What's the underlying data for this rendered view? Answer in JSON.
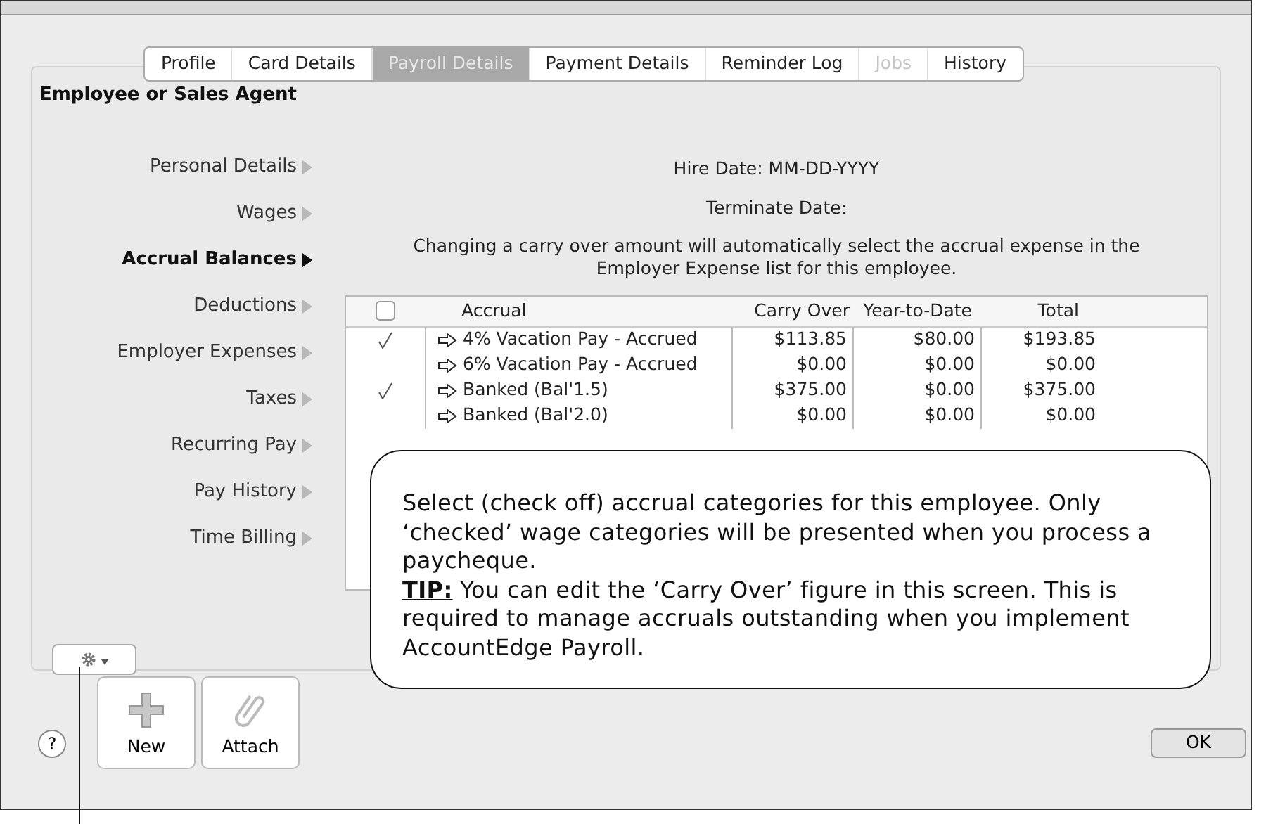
{
  "tabs": [
    {
      "label": "Profile",
      "selected": false,
      "disabled": false
    },
    {
      "label": "Card Details",
      "selected": false,
      "disabled": false
    },
    {
      "label": "Payroll Details",
      "selected": true,
      "disabled": false
    },
    {
      "label": "Payment Details",
      "selected": false,
      "disabled": false
    },
    {
      "label": "Reminder Log",
      "selected": false,
      "disabled": false
    },
    {
      "label": "Jobs",
      "selected": false,
      "disabled": true
    },
    {
      "label": "History",
      "selected": false,
      "disabled": false
    }
  ],
  "panel_title": "Employee or Sales Agent",
  "sidebar": {
    "items": [
      {
        "label": "Personal Details",
        "selected": false
      },
      {
        "label": "Wages",
        "selected": false
      },
      {
        "label": "Accrual Balances",
        "selected": true
      },
      {
        "label": "Deductions",
        "selected": false
      },
      {
        "label": "Employer Expenses",
        "selected": false
      },
      {
        "label": "Taxes",
        "selected": false
      },
      {
        "label": "Recurring Pay",
        "selected": false
      },
      {
        "label": "Pay History",
        "selected": false
      },
      {
        "label": "Time Billing",
        "selected": false
      }
    ]
  },
  "hire_date": {
    "label": "Hire Date:",
    "value": "MM-DD-YYYY"
  },
  "terminate_date": {
    "label": "Terminate Date:"
  },
  "note": "Changing a carry over amount will automatically select the accrual expense in the Employer Expense list for this employee.",
  "table": {
    "header_checked": false,
    "columns": [
      "Accrual",
      "Carry Over",
      "Year-to-Date",
      "Total"
    ],
    "rows": [
      {
        "checked": true,
        "accrual": "4% Vacation Pay - Accrued",
        "carry_over": "$113.85",
        "year_to_date": "$80.00",
        "total": "$193.85"
      },
      {
        "checked": false,
        "accrual": "6% Vacation Pay - Accrued",
        "carry_over": "$0.00",
        "year_to_date": "$0.00",
        "total": "$0.00"
      },
      {
        "checked": true,
        "accrual": "Banked (Bal'1.5)",
        "carry_over": "$375.00",
        "year_to_date": "$0.00",
        "total": "$375.00"
      },
      {
        "checked": false,
        "accrual": "Banked (Bal'2.0)",
        "carry_over": "$0.00",
        "year_to_date": "$0.00",
        "total": "$0.00"
      }
    ]
  },
  "callout": {
    "text": "Select (check off) accrual categories for this employee. Only ‘checked’ wage categories will be presented when you process a paycheque.",
    "tip_label": "TIP:",
    "tip_text": "You can edit the ‘Carry Over’ figure in this screen. This is required to manage accruals outstanding when you implement AccountEdge Payroll."
  },
  "buttons": {
    "help": "?",
    "new": "New",
    "attach": "Attach",
    "ok": "OK"
  }
}
